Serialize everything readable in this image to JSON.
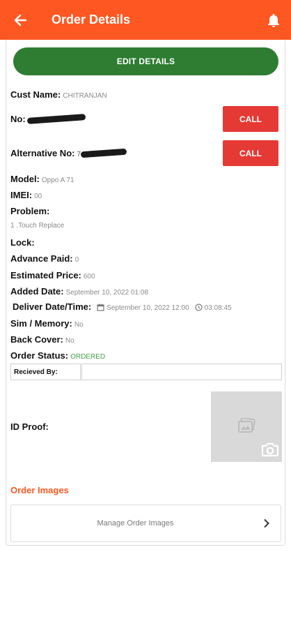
{
  "appbar": {
    "title": "Order Details",
    "back_icon": "arrow-left-icon",
    "bell_icon": "bell-icon",
    "color": "#ff5722"
  },
  "edit_button": {
    "label": "EDIT DETAILS",
    "color": "#2e7d32"
  },
  "fields": {
    "cust_name": {
      "label": "Cust Name:",
      "value": "CHITRANJAN"
    },
    "number": {
      "label": "No:",
      "value": ""
    },
    "alt_number": {
      "label": "Alternative No:",
      "value": "7"
    },
    "model": {
      "label": "Model:",
      "value": "Oppo A 71"
    },
    "imei": {
      "label": "IMEI:",
      "value": "00"
    },
    "problem": {
      "label": "Problem:",
      "value": "1 .Touch Replace"
    },
    "lock": {
      "label": "Lock:",
      "value": ""
    },
    "advance_paid": {
      "label": "Advance Paid:",
      "value": "0"
    },
    "estimated_price": {
      "label": "Estimated Price:",
      "value": "600"
    },
    "added_date": {
      "label": "Added Date:",
      "value": "September 10, 2022 01:08"
    },
    "deliver": {
      "label": "Deliver Date/Time:",
      "date": "September 10, 2022 12:00",
      "time": "03:08:45"
    },
    "sim_memory": {
      "label": "Sim / Memory:",
      "value": "No"
    },
    "back_cover": {
      "label": "Back Cover:",
      "value": "No"
    },
    "order_status": {
      "label": "Order Status:",
      "value": "ORDERED",
      "color": "#43a047"
    },
    "received_by": {
      "label": "Recieved By:",
      "value": ""
    },
    "id_proof": {
      "label": "ID Proof:"
    }
  },
  "call_buttons": {
    "label": "CALL",
    "color": "#e53935"
  },
  "order_images": {
    "title": "Order Images",
    "manage_label": "Manage Order Images"
  }
}
